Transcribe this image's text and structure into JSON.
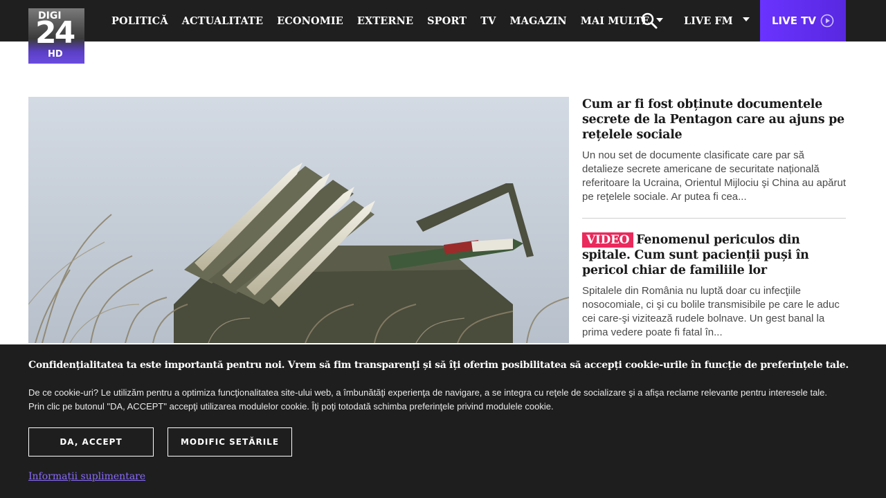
{
  "logo": {
    "brand": "DIGI",
    "number": "24",
    "suffix": "HD"
  },
  "nav": {
    "items": [
      "POLITICĂ",
      "ACTUALITATE",
      "ECONOMIE",
      "EXTERNE",
      "SPORT",
      "TV",
      "MAGAZIN"
    ],
    "more_label": "MAI MULTE",
    "search_icon": "search-icon",
    "live_fm_label": "LIVE FM",
    "live_tv_label": "LIVE TV",
    "live_tv_icon": "play-circle-icon"
  },
  "colors": {
    "topbar": "#1f1f1f",
    "live_tv": "#6a33ff",
    "video_tag": "#ea2a5c",
    "link": "#8a6cff"
  },
  "hero": {
    "image_icon": "missile-launcher-photo"
  },
  "articles": [
    {
      "title": "Cum ar fi fost obținute documentele secrete de la Pentagon care au ajuns pe rețelele sociale",
      "summary": "Un nou set de documente clasificate care par să detalieze secrete americane de securitate națională referitoare la Ucraina, Orientul Mijlociu şi China au apărut pe reţelele sociale. Ar putea fi cea..."
    },
    {
      "tag": "VIDEO",
      "title": "Fenomenul periculos din spitale. Cum sunt pacienții puși în pericol chiar de familiile lor",
      "summary": "Spitalele din România nu luptă doar cu infecţiile nosocomiale, ci şi cu bolile transmisibile pe care le aduc cei care-şi vizitează rudele bolnave. Un gest banal la prima vedere poate fi fatal în..."
    }
  ],
  "cookie": {
    "title": "Confidențialitatea ta este importantă pentru noi. Vrem să fim transparenți și să îți oferim posibilitatea să accepți cookie-urile în funcție de preferințele tale.",
    "text_line1": "De ce cookie-uri? Le utilizăm pentru a optimiza funcţionalitatea site-ului web, a îmbunătăţi experienţa de navigare, a se integra cu reţele de socializare şi a afişa reclame relevante pentru interesele tale.",
    "text_line2": "Prin clic pe butonul \"DA, ACCEPT\" accepţi utilizarea modulelor cookie. Îţi poţi totodată schimba preferinţele privind modulele cookie.",
    "accept_label": "DA, ACCEPT",
    "settings_label": "MODIFIC SETĂRILE",
    "more_info_label": "Informații suplimentare"
  }
}
